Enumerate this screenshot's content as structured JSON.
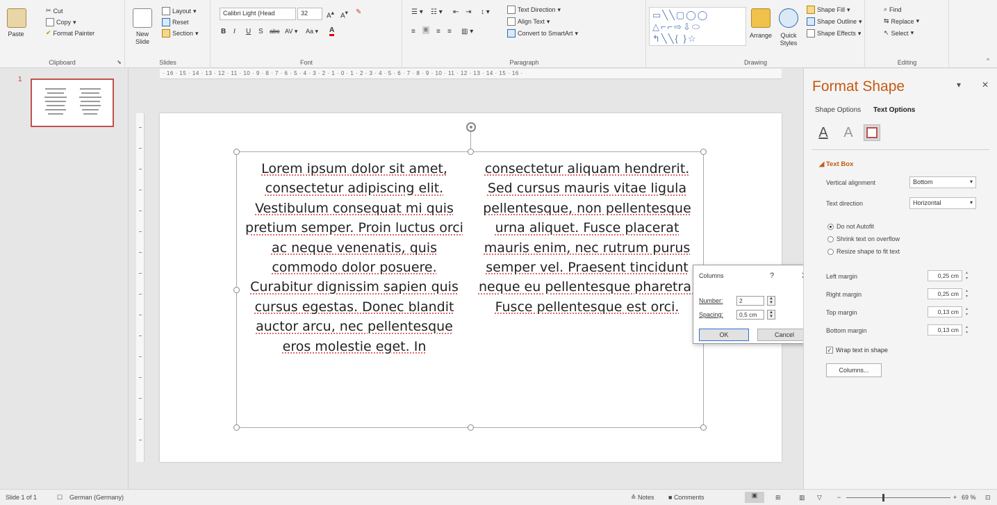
{
  "ribbon": {
    "clipboard": {
      "paste": "Paste",
      "cut": "Cut",
      "copy": "Copy",
      "format_painter": "Format Painter",
      "label": "Clipboard"
    },
    "slides": {
      "new_slide": "New Slide",
      "layout": "Layout",
      "reset": "Reset",
      "section": "Section",
      "label": "Slides"
    },
    "font": {
      "family": "Calibri Light (Head",
      "size": "32",
      "label": "Font"
    },
    "paragraph": {
      "text_direction": "Text Direction",
      "align_text": "Align Text",
      "convert_smartart": "Convert to SmartArt",
      "label": "Paragraph"
    },
    "drawing": {
      "arrange": "Arrange",
      "quick_styles": "Quick Styles",
      "shape_fill": "Shape Fill",
      "shape_outline": "Shape Outline",
      "shape_effects": "Shape Effects",
      "label": "Drawing"
    },
    "editing": {
      "find": "Find",
      "replace": "Replace",
      "select": "Select",
      "label": "Editing"
    }
  },
  "ruler": {
    "horizontal": "· 16 · 15 · 14 · 13 · 12 · 11 · 10 · 9 · 8 · 7 · 6 · 5 · 4 · 3 · 2 · 1 · 0 · 1 · 2 · 3 · 4 · 5 · 6 · 7 · 8 · 9 · 10 · 11 · 12 · 13 · 14 · 15 · 16 ·"
  },
  "thumbnails": {
    "slide_number": "1"
  },
  "slide": {
    "column1": "Lorem ipsum dolor sit amet, consectetur adipiscing elit. Vestibulum consequat mi quis pretium semper. Proin luctus orci ac neque venenatis, quis commodo dolor posuere. Curabitur dignissim sapien quis cursus egestas. Donec blandit auctor arcu, nec pellentesque eros molestie eget. In",
    "column2": "consectetur aliquam hendrerit. Sed cursus mauris vitae ligula pellentesque, non pellentesque urna aliquet. Fusce placerat mauris enim, nec rutrum purus semper vel. Praesent tincidunt neque eu pellentesque pharetra. Fusce pellentesque est orci."
  },
  "columns_dialog": {
    "title": "Columns",
    "help": "?",
    "close": "✕",
    "number_label": "Number:",
    "number_value": "2",
    "spacing_label": "Spacing:",
    "spacing_value": "0,5 cm",
    "ok": "OK",
    "cancel": "Cancel"
  },
  "format_pane": {
    "title": "Format Shape",
    "tab_shape": "Shape Options",
    "tab_text": "Text Options",
    "section": "Text Box",
    "vertical_alignment_label": "Vertical alignment",
    "vertical_alignment_value": "Bottom",
    "text_direction_label": "Text direction",
    "text_direction_value": "Horizontal",
    "autofit_options": [
      "Do not Autofit",
      "Shrink text on overflow",
      "Resize shape to fit text"
    ],
    "left_margin_label": "Left margin",
    "left_margin": "0,25 cm",
    "right_margin_label": "Right margin",
    "right_margin": "0,25 cm",
    "top_margin_label": "Top margin",
    "top_margin": "0,13 cm",
    "bottom_margin_label": "Bottom margin",
    "bottom_margin": "0,13 cm",
    "wrap_text": "Wrap text in shape",
    "columns_button": "Columns..."
  },
  "status": {
    "slide_info": "Slide 1 of 1",
    "language": "German (Germany)",
    "notes": "Notes",
    "comments": "Comments",
    "zoom": "69 %"
  }
}
